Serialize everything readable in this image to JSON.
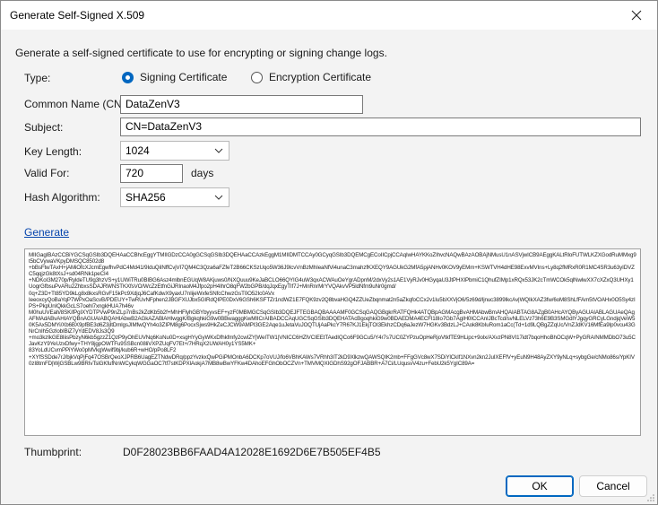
{
  "window": {
    "title": "Generate Self-Signed X.509"
  },
  "intro": "Generate a self-signed certificate to use for encrypting or signing change logs.",
  "type": {
    "label": "Type:",
    "options": [
      {
        "label": "Signing Certificate",
        "selected": true
      },
      {
        "label": "Encryption Certificate",
        "selected": false
      }
    ]
  },
  "common_name": {
    "label": "Common Name (CN):",
    "value": "DataZenV3"
  },
  "subject": {
    "label": "Subject:",
    "value": "CN=DataZenV3"
  },
  "key_length": {
    "label": "Key Length:",
    "value": "1024"
  },
  "valid_for": {
    "label": "Valid For:",
    "value": "720",
    "unit": "days"
  },
  "hash_algorithm": {
    "label": "Hash Algorithm:",
    "value": "SHA256"
  },
  "generate_link": "Generate",
  "certificate_text": "MIIGagIBAzCCBiYGCSqGSIb3DQEHAaCCBhcEggYTMIIGDzCCA0gGCSqGSIb3DQEHAaCCAzkEggM1MIIDMTCCAy0GCyqGSIb3DQEMCgECoIICpjCCAqIwHAYKKoZIhvcNAQwBAzAOBAjNMusU1nASVjwICB9AEggKALtRloFUTWLKZXGodRuMMxg9t5bCVywaVKpyDMSQC8502d8\n+bBsFtwTAxH+jAMiOfcXJcmEgwfhvPdC4Md41/9IduQiINffCvjVI7QM4C3Qza6aFZfeT2B66CKSzUqo5W36J9IcvVnBzMhIeaNfVi4unaC3mahzfKXEQY9AGUkG2MfA5pjANHv0KOV9yEMm+KSWTVH4dHE98ExvMVIns+Ly8q2fMRxR0R1MC4SR3u63yIDVZC5qqjzGk8tXsJ+sd04RNk1peCI4\n+NDKoI3M270p/RyldeTU9g3hzVS+y1UWiTRu0BIBG6Asz4mlbnEGUqW8AKjuws0/NXQuuu9KeJaBCLO66QYIG4uW3qxACWAuOeYgrADpnM/2dxVy2s1AE1VyRJv0HGyqaU3JtPHXIPbmiC1QhufZIMp1xRQx53JK2cTmWCOk5qlNwlwXX7cXZxQ3UHXy1UogrGfbsuPvARu2ZhbxsSDAJRWNSTKXfsVO/WcZzEtfnGiJRInaoM4Jfpo2pH4IhrO8qFW2bGPB/dqJqxEgyTIf7J+MnRnrMrYVQAkvVP5ldNfm9uNr0gmd/\n0q+Z3D+Tt85YD9kLg8x8kxsRGvF15kPc9XdjqJ6CafKdwX9yaxU7nIijeWxfeSNfcChwzGsT0O52Ic0AVx\nIeeoxcyQoBaYqP7WPxOaScvB/PDEUY+TwRUvNFphen2JBGFXUJbx5GIRdQIPE0DxV6GSh6KSFTZr1ndWZ1E7FQK9zv2Q8bvaHGQ4ZZUeZbqnmat2n5aZkqfoCCx2v1Iu5bXXVjO6/5z69d/ljnuc3899IkcAv|WQIkXAZ3fw/6oM8ShLfFAm5tVOAHx0O5Sy4zIPS+PkpUnIQkkGcLS7oehl7xngkHUA7h46v\nM0huUVEah/8SKifPgIXYDTPVwP9nZLp7nBs2kZdKb5b2f+MhHFlyhGBYbyyvsEF+yzF0MBMGCSqGSIb3DQEJFTEGBAQBAAAAMF0GCSqGAQGBgkrRATFQHk4ATQBpAGMAcgBvAHMAbwBmAHQAIABTAG8AZgB0AHcAYQByAGUAIABLAGUAeQAgAFMAdABvAHIAYQBnAGUAIABQAHIAbwB2AGkAZABlAHIwggK/BgkqhkiG9w0BBwagggKwMIICrAIBADCCAqUGCSqGSIb3DQEHATAcBgoqhkiG9w0BDAEDMA4ECFl18Io7Gb7AgIH0ICCAnIJBcTcd/svNLELVz73h6E9B3SMGdlYJgqyGRCyLGndjqVeW50K5Ax5DMYi/Xb6BX9pfBE3d6Z3jItDmlgsJIMfwQYh4o3ZIPM8g6PocxSjws9HkZeCJCW9AMPI3GE2Aqe1uJetaVuJOQTUjAaPkcY7R67KJ1EkjTOI3EkhzCDq6aJezW7HGKv3BdzLJ+CAok8KbIuRom1aCc(Td+1d9LQBgZZqUc/VnZJdKV16MfEa9Ip0vcu43GNrCnIh5GzlobIBiZ7yYdEDV8Js3Q9\n+mo3kzIkGE8IiisPbzyN6kb5gzzZ1QzP9yOhEUVNq6KoNu0D+xsgHYyGyWKxDfhkfmfy2cwIZY|WeITW1|VNICC6HZlVCIEEtTAedIQCo6F9GCu5/Y4r7s7UC0ZYPzuOpHeRjoVtkfTE9HLipc+9olx/AXvzPN8VI17idt7bqoHhoBhOCqW+PyGRA/NMMDbO73u5CJavKzY9YeUzxDfwy+THY8jgpOWTFu9SSBcn08liVXPZUqFV7Et+/7HRqX2UWAH0y1YS5MK+\n83YoLdUCvmPPiYWo0pMVkgWwif9bj/kub6R+wHO/pPo8LF2\n+XYfSSDde7rJ/bjkVqPjFq47OSBrQeoXJPRB6UagEZTNdwDRq/ppzYvzkxQwPGiPMOnbA6DCKp7oVUJ/fo6VBhKAWs7VRhh3IT2kD9XlkzwQAWSQIK2mb+FFgGVc8wX7SDiYlCkIf1NXvn2kn2JuIXEFfV+yEuN9H48AyZXY9yNLq+sybgGe/cNMo86s/YpKIV0zI8tmFD|WjGSBLw9BRIvTslGKfufNnWCykqWGGaOC7tf7stKDPXlAokjA7MB8wBwYFKw4DAhoEFGhObOCZVn+TMVMQXIGDhS92gOFJABBR+A7Ci/LUqusvV4zu+FebU2k5YgIC89A=",
  "thumbprint": {
    "label": "Thumbprint:",
    "value": "D0F28023BB6FAAD4A12028E1692D6E7B505EF4B5"
  },
  "buttons": {
    "ok": "OK",
    "cancel": "Cancel"
  }
}
